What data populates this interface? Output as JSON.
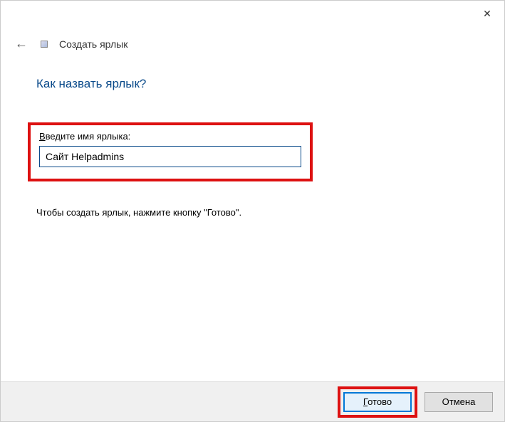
{
  "titlebar": {
    "close": "✕"
  },
  "header": {
    "back": "←",
    "title": "Создать ярлык"
  },
  "main": {
    "title": "Как назвать ярлык?",
    "label_first": "В",
    "label_rest": "ведите имя ярлыка:",
    "input_value": "Сайт Helpadmins",
    "info": "Чтобы создать ярлык, нажмите кнопку \"Готово\"."
  },
  "footer": {
    "finish_first": "Г",
    "finish_rest": "отово",
    "cancel": "Отмена"
  }
}
